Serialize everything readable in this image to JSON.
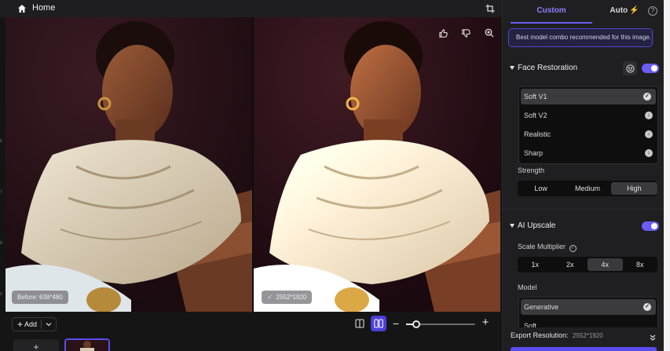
{
  "topbar": {
    "home_label": "Home"
  },
  "viewer": {
    "before_badge": "Before: 638*480",
    "after_badge": "2552*1920"
  },
  "bottombar": {
    "add_label": "Add",
    "zoom_level": 0.15
  },
  "panel": {
    "tabs": {
      "custom": "Custom",
      "auto": "Auto"
    },
    "tip": "Best model combo recommended for this image.",
    "face_restoration": {
      "title": "Face Restoration",
      "enabled": true,
      "models": [
        {
          "label": "Soft V1",
          "state": "selected"
        },
        {
          "label": "Soft V2",
          "state": "download"
        },
        {
          "label": "Realistic",
          "state": "download"
        },
        {
          "label": "Sharp",
          "state": "download"
        }
      ],
      "strength_label": "Strength",
      "strength_options": [
        "Low",
        "Medium",
        "High"
      ],
      "strength_selected": "High"
    },
    "ai_upscale": {
      "title": "AI Upscale",
      "enabled": true,
      "scale_label": "Scale Multiplier",
      "scale_options": [
        "1x",
        "2x",
        "4x",
        "8x"
      ],
      "scale_selected": "4x",
      "model_label": "Model",
      "models": [
        {
          "label": "Generative",
          "state": "selected"
        },
        {
          "label": "Soft",
          "state": "download"
        }
      ]
    },
    "export": {
      "label": "Export Resolution:",
      "value": "2552*1920"
    }
  },
  "colors": {
    "accent": "#6b5cf6",
    "accent_text": "#8d80ff",
    "bolt": "#f2b61c",
    "panel_bg": "#1f1f21"
  }
}
